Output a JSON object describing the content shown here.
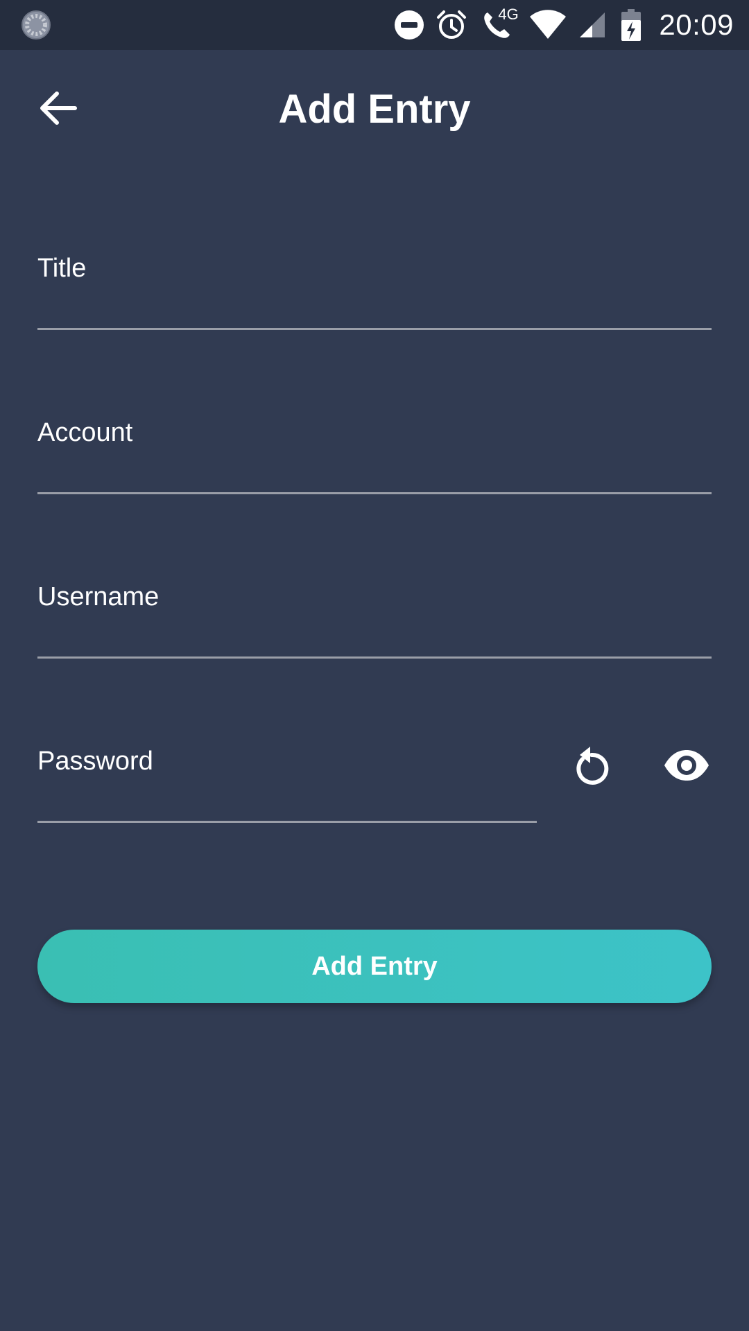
{
  "status_bar": {
    "time": "20:09",
    "network_type": "4G",
    "icons": [
      "loading-circle-icon",
      "do-not-disturb-icon",
      "alarm-icon",
      "wifi-calling-icon",
      "wifi-icon",
      "cell-signal-icon",
      "battery-charging-icon"
    ]
  },
  "toolbar": {
    "title": "Add Entry",
    "back_icon": "arrow-back-icon"
  },
  "form": {
    "title_label": "Title",
    "title_value": "",
    "account_label": "Account",
    "account_value": "",
    "username_label": "Username",
    "username_value": "",
    "password_label": "Password",
    "password_value": "",
    "regenerate_icon": "refresh-icon",
    "visibility_icon": "eye-icon"
  },
  "actions": {
    "add_entry_label": "Add Entry"
  },
  "colors": {
    "background": "#313b52",
    "status_bar": "#252d3e",
    "accent_start": "#3abfb3",
    "accent_end": "#3dc3c8",
    "underline": "#9a9ea8"
  }
}
